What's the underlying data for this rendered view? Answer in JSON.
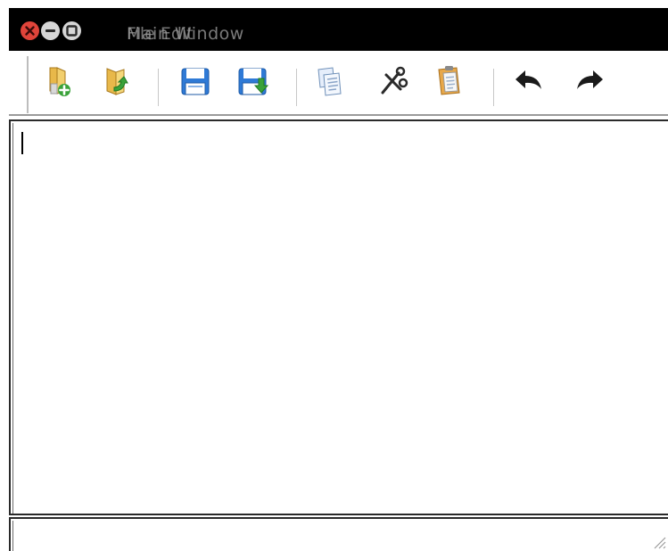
{
  "window": {
    "title_layer_a": "Main Window",
    "title_layer_b": "File  Edit",
    "buttons": {
      "close": "close-icon",
      "minimize": "minimize-icon",
      "maximize": "maximize-icon"
    }
  },
  "toolbar": {
    "groups": [
      [
        "new-file-icon",
        "open-folder-icon"
      ],
      [
        "save-icon",
        "save-as-icon"
      ],
      [
        "copy-icon",
        "cut-icon",
        "paste-icon"
      ],
      [
        "undo-icon",
        "redo-icon"
      ]
    ]
  },
  "editor": {
    "content": "",
    "placeholder": ""
  },
  "statusbar": {
    "text": ""
  },
  "colors": {
    "titlebar": "#000000",
    "close_button": "#e0443a",
    "window_button": "#d6d6d6",
    "save_blue": "#2f7ad6",
    "folder_yellow": "#e8b84a",
    "arrow_green": "#3aa23a",
    "toolbar_separator": "#c8c8c8"
  }
}
